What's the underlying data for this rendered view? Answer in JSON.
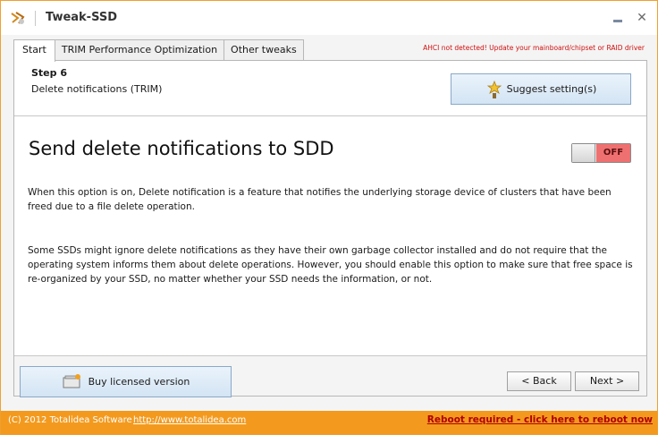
{
  "window": {
    "title": "Tweak-SSD",
    "minimize_glyph": "",
    "close_glyph": "✕"
  },
  "tabs": [
    {
      "label": "Start",
      "active": true
    },
    {
      "label": "TRIM Performance Optimization",
      "active": false
    },
    {
      "label": "Other tweaks",
      "active": false
    }
  ],
  "warning": "AHCI not detected! Update your mainboard/chipset or RAID driver",
  "step": {
    "title": "Step 6",
    "subtitle": "Delete notifications (TRIM)"
  },
  "suggest_button": {
    "label": "Suggest setting(s)",
    "icon": "lamp-icon"
  },
  "option": {
    "title": "Send delete notifications to SDD",
    "toggle_state": "OFF",
    "paragraph1": "When this option is on, Delete notification is a feature that notifies the underlying storage device of clusters that have been freed due to a file delete operation.",
    "paragraph2": "Some SSDs might ignore delete notifications as they have their own garbage collector installed and do not require that the operating system informs them about delete operations. However, you should enable this option to make sure that free space is re-organized by your SSD, no matter whether your SSD needs the information, or not."
  },
  "footer": {
    "buy_label": "Buy licensed version",
    "buy_icon": "cart-icon",
    "back_label": "< Back",
    "next_label": "Next >"
  },
  "statusbar": {
    "copyright": "(C) 2012 Totalidea Software",
    "website": "http://www.totalidea.com",
    "reboot": "Reboot required - click here to reboot now"
  },
  "colors": {
    "accent_orange": "#f39a1e",
    "toggle_off": "#ef7070",
    "warning_red": "#d01010"
  }
}
